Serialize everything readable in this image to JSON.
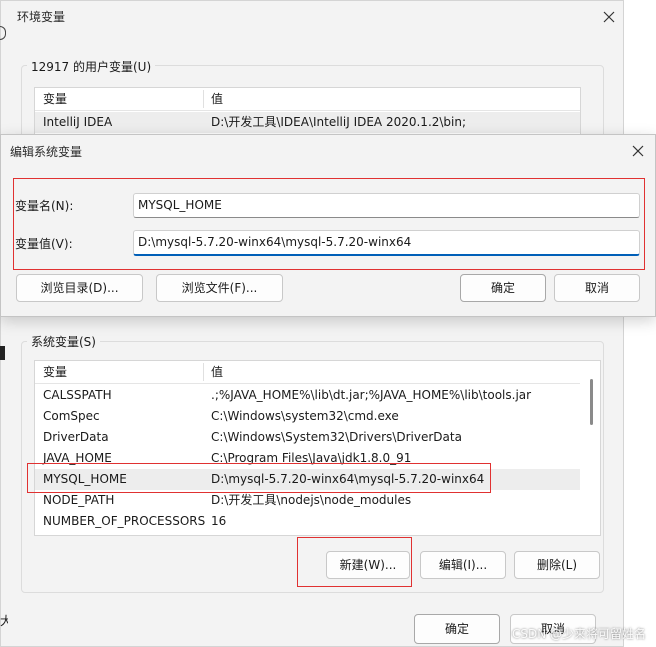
{
  "env_window": {
    "title": "环境变量",
    "user_section": {
      "title": "12917 的用户变量(U)",
      "columns": [
        "变量",
        "值"
      ],
      "rows": [
        {
          "name": "IntelliJ IDEA",
          "value": "D:\\开发工具\\IDEA\\IntelliJ IDEA 2020.1.2\\bin;"
        }
      ]
    },
    "system_section": {
      "title": "系统变量(S)",
      "columns": [
        "变量",
        "值"
      ],
      "rows": [
        {
          "name": "CALSSPATH",
          "value": ".;%JAVA_HOME%\\lib\\dt.jar;%JAVA_HOME%\\lib\\tools.jar"
        },
        {
          "name": "ComSpec",
          "value": "C:\\Windows\\system32\\cmd.exe"
        },
        {
          "name": "DriverData",
          "value": "C:\\Windows\\System32\\Drivers\\DriverData"
        },
        {
          "name": "JAVA_HOME",
          "value": "C:\\Program Files\\Java\\jdk1.8.0_91"
        },
        {
          "name": "MYSQL_HOME",
          "value": "D:\\mysql-5.7.20-winx64\\mysql-5.7.20-winx64"
        },
        {
          "name": "NODE_PATH",
          "value": "D:\\开发工具\\nodejs\\node_modules"
        },
        {
          "name": "NUMBER_OF_PROCESSORS",
          "value": "16"
        }
      ],
      "selected_row": "MYSQL_HOME",
      "buttons": {
        "new": "新建(W)...",
        "edit": "编辑(I)...",
        "delete": "删除(L)"
      }
    },
    "footer": {
      "ok": "确定",
      "cancel": "取消"
    }
  },
  "edit_dialog": {
    "title": "编辑系统变量",
    "var_name_label": "变量名(N):",
    "var_name_value": "MYSQL_HOME",
    "var_value_label": "变量值(V):",
    "var_value_value": "D:\\mysql-5.7.20-winx64\\mysql-5.7.20-winx64",
    "buttons": {
      "browse_dir": "浏览目录(D)...",
      "browse_file": "浏览文件(F)...",
      "ok": "确定",
      "cancel": "取消"
    }
  },
  "side_fragment": "大",
  "watermark": "CSDN @少来将可留姓名"
}
